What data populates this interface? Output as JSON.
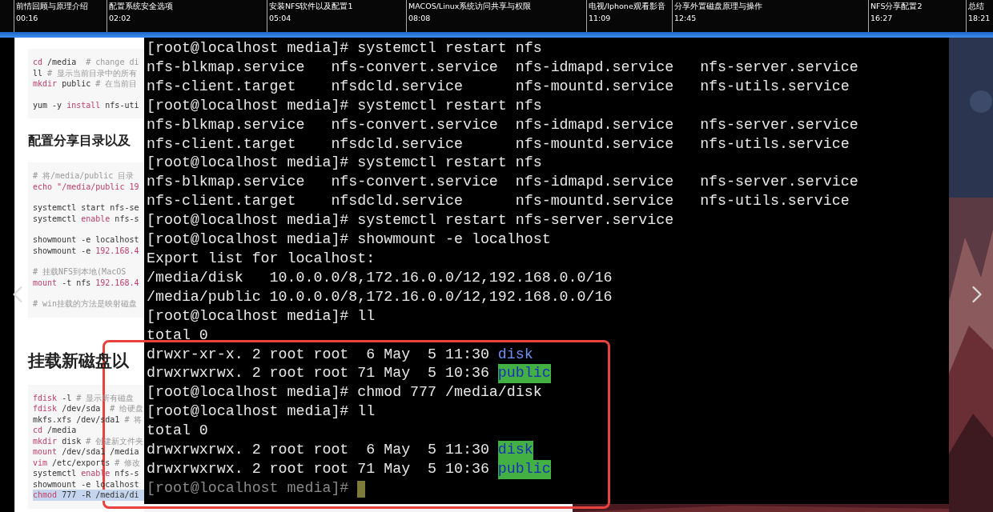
{
  "chapters": [
    {
      "title": "前情回顾与原理介绍",
      "time": "00:16"
    },
    {
      "title": "配置系统安全选项",
      "time": "02:02"
    },
    {
      "title": "安装NFS软件以及配置1",
      "time": "05:04"
    },
    {
      "title": "MACOS/Linux系统访问共享与权限",
      "time": "08:08"
    },
    {
      "title": "电视/Iphone观看影音",
      "time": "11:09"
    },
    {
      "title": "分享外置磁盘原理与操作",
      "time": "12:45"
    },
    {
      "title": "NFS分享配置2",
      "time": "16:27"
    },
    {
      "title": "总结",
      "time": "18:21"
    }
  ],
  "doc": {
    "sections": [
      {
        "groups": [
          [
            {
              "selected": false,
              "segs": [
                {
                  "kind": "keyword",
                  "t": "cd"
                },
                {
                  "kind": "plain",
                  "t": " /media  "
                },
                {
                  "kind": "comment",
                  "t": "# change di"
                }
              ]
            },
            {
              "selected": false,
              "segs": [
                {
                  "kind": "plain",
                  "t": "ll "
                },
                {
                  "kind": "comment",
                  "t": "# 显示当前目录中的所有"
                }
              ]
            },
            {
              "selected": false,
              "segs": [
                {
                  "kind": "keyword",
                  "t": "mkdir"
                },
                {
                  "kind": "plain",
                  "t": " public "
                },
                {
                  "kind": "comment",
                  "t": "# 在当前目"
                }
              ]
            }
          ],
          [
            {
              "selected": false,
              "segs": [
                {
                  "kind": "plain",
                  "t": "yum -y "
                },
                {
                  "kind": "keyword",
                  "t": "install"
                },
                {
                  "kind": "plain",
                  "t": " nfs-uti"
                }
              ]
            }
          ]
        ]
      },
      {
        "heading": "配置分享目录以及",
        "kind": "minor",
        "groups": [
          [
            {
              "selected": false,
              "segs": [
                {
                  "kind": "comment",
                  "t": "# 将/media/public 目录"
                }
              ]
            },
            {
              "selected": false,
              "segs": [
                {
                  "kind": "keyword",
                  "t": "echo"
                },
                {
                  "kind": "keyword",
                  "t": " \"/media/public 19"
                }
              ]
            }
          ],
          [
            {
              "selected": false,
              "segs": [
                {
                  "kind": "plain",
                  "t": "systemctl start nfs-se"
                }
              ]
            },
            {
              "selected": false,
              "segs": [
                {
                  "kind": "plain",
                  "t": "systemctl "
                },
                {
                  "kind": "keyword",
                  "t": "enable"
                },
                {
                  "kind": "plain",
                  "t": " nfs-s"
                }
              ]
            }
          ],
          [
            {
              "selected": false,
              "segs": [
                {
                  "kind": "plain",
                  "t": "showmount -e localhost"
                }
              ]
            },
            {
              "selected": false,
              "segs": [
                {
                  "kind": "plain",
                  "t": "showmount -e "
                },
                {
                  "kind": "keyword",
                  "t": "192.168.4"
                }
              ]
            }
          ],
          [
            {
              "selected": false,
              "segs": [
                {
                  "kind": "comment",
                  "t": "# 挂载NFS到本地(MacOS"
                }
              ]
            },
            {
              "selected": false,
              "segs": [
                {
                  "kind": "keyword",
                  "t": "mount"
                },
                {
                  "kind": "plain",
                  "t": " -t nfs "
                },
                {
                  "kind": "keyword",
                  "t": "192.168.4"
                }
              ]
            }
          ],
          [
            {
              "selected": false,
              "segs": [
                {
                  "kind": "comment",
                  "t": "# win挂载的方法是映射磁盘"
                }
              ]
            }
          ]
        ]
      },
      {
        "heading": "挂载新磁盘以",
        "kind": "major",
        "groups": [
          [
            {
              "selected": false,
              "segs": [
                {
                  "kind": "keyword",
                  "t": "fdisk"
                },
                {
                  "kind": "plain",
                  "t": " -l "
                },
                {
                  "kind": "comment",
                  "t": "# 显示所有磁盘"
                }
              ]
            },
            {
              "selected": false,
              "segs": [
                {
                  "kind": "keyword",
                  "t": "fdisk"
                },
                {
                  "kind": "plain",
                  "t": " /dev/sda  "
                },
                {
                  "kind": "comment",
                  "t": "# 给硬盘"
                }
              ]
            },
            {
              "selected": false,
              "segs": [
                {
                  "kind": "plain",
                  "t": "mkfs.xfs /dev/sda1 "
                },
                {
                  "kind": "comment",
                  "t": "# 将"
                }
              ]
            },
            {
              "selected": false,
              "segs": [
                {
                  "kind": "keyword",
                  "t": "cd"
                },
                {
                  "kind": "plain",
                  "t": " /media"
                }
              ]
            },
            {
              "selected": false,
              "segs": [
                {
                  "kind": "keyword",
                  "t": "mkdir"
                },
                {
                  "kind": "plain",
                  "t": " disk "
                },
                {
                  "kind": "comment",
                  "t": "# 创建新文件夹"
                }
              ]
            },
            {
              "selected": false,
              "segs": [
                {
                  "kind": "keyword",
                  "t": "mount"
                },
                {
                  "kind": "plain",
                  "t": " /dev/sda1 /media"
                }
              ]
            },
            {
              "selected": false,
              "segs": [
                {
                  "kind": "keyword",
                  "t": "vim"
                },
                {
                  "kind": "plain",
                  "t": " /etc/exports "
                },
                {
                  "kind": "comment",
                  "t": "# 修改"
                }
              ]
            },
            {
              "selected": false,
              "segs": [
                {
                  "kind": "plain",
                  "t": "systemctl "
                },
                {
                  "kind": "keyword",
                  "t": "enable"
                },
                {
                  "kind": "plain",
                  "t": " nfs-s"
                }
              ]
            },
            {
              "selected": false,
              "segs": [
                {
                  "kind": "plain",
                  "t": "showmount -e localhost"
                }
              ]
            },
            {
              "selected": true,
              "segs": [
                {
                  "kind": "keyword",
                  "t": "chmod"
                },
                {
                  "kind": "plain",
                  "t": " 777 -R /media/di"
                }
              ]
            }
          ]
        ]
      }
    ]
  },
  "terminal": {
    "lines": [
      {
        "text": "[root@localhost media]# systemctl restart nfs"
      },
      {
        "text": "nfs-blkmap.service   nfs-convert.service  nfs-idmapd.service   nfs-server.service"
      },
      {
        "text": "nfs-client.target    nfsdcld.service      nfs-mountd.service   nfs-utils.service"
      },
      {
        "text": "[root@localhost media]# systemctl restart nfs"
      },
      {
        "text": "nfs-blkmap.service   nfs-convert.service  nfs-idmapd.service   nfs-server.service"
      },
      {
        "text": "nfs-client.target    nfsdcld.service      nfs-mountd.service   nfs-utils.service"
      },
      {
        "text": "[root@localhost media]# systemctl restart nfs"
      },
      {
        "text": "nfs-blkmap.service   nfs-convert.service  nfs-idmapd.service   nfs-server.service"
      },
      {
        "text": "nfs-client.target    nfsdcld.service      nfs-mountd.service   nfs-utils.service"
      },
      {
        "text": "[root@localhost media]# systemctl restart nfs-server.service"
      },
      {
        "text": "[root@localhost media]# showmount -e localhost"
      },
      {
        "text": "Export list for localhost:"
      },
      {
        "text": "/media/disk   10.0.0.0/8,172.16.0.0/12,192.168.0.0/16"
      },
      {
        "text": "/media/public 10.0.0.0/8,172.16.0.0/12,192.168.0.0/16"
      },
      {
        "text": "[root@localhost media]# ll"
      },
      {
        "text": "total 0"
      },
      {
        "text": "drwxr-xr-x. 2 root root  6 May  5 11:30 ",
        "entry": {
          "text": "disk",
          "kind": "dir"
        }
      },
      {
        "text": "drwxrwxrwx. 2 root root 71 May  5 10:36 ",
        "entry": {
          "text": "public",
          "kind": "shared_dir"
        }
      },
      {
        "text": "[root@localhost media]# chmod 777 /media/disk"
      },
      {
        "text": "[root@localhost media]# ll"
      },
      {
        "text": "total 0"
      },
      {
        "text": "drwxrwxrwx. 2 root root  6 May  5 11:30 ",
        "entry": {
          "text": "disk",
          "kind": "shared_dir"
        }
      },
      {
        "text": "drwxrwxrwx. 2 root root 71 May  5 10:36 ",
        "entry": {
          "text": "public",
          "kind": "shared_dir"
        }
      }
    ],
    "prompt": {
      "text": "[root@localhost media]# "
    }
  }
}
